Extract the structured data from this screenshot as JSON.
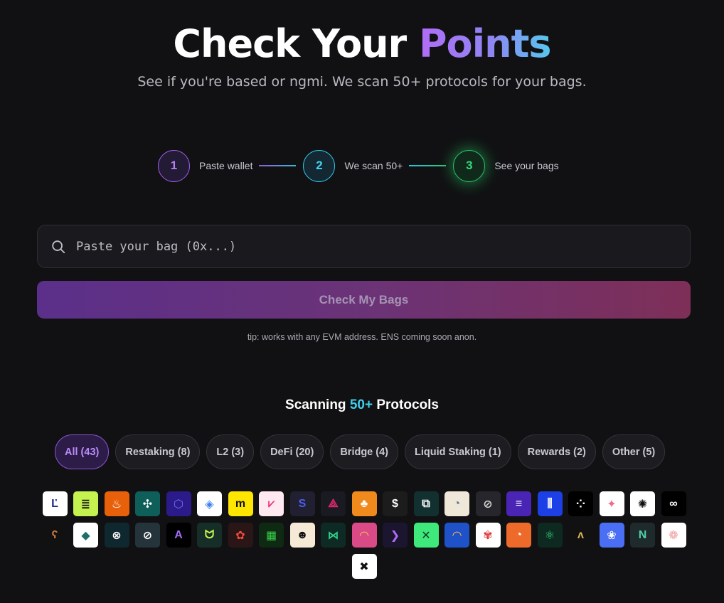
{
  "hero": {
    "title_main": "Check Your ",
    "title_accent": "Points",
    "subtitle": "See if you're based or ngmi. We scan 50+ protocols for your bags."
  },
  "steps": [
    {
      "number": "1",
      "label": "Paste wallet"
    },
    {
      "number": "2",
      "label": "We scan 50+"
    },
    {
      "number": "3",
      "label": "See your bags"
    }
  ],
  "search": {
    "placeholder": "Paste your bag (0x...)",
    "value": ""
  },
  "cta": {
    "label": "Check My Bags"
  },
  "tip": "tip: works with any EVM address. ENS coming soon anon.",
  "scanning": {
    "prefix": "Scanning ",
    "count": "50+",
    "suffix": " Protocols"
  },
  "filters": [
    {
      "label": "All (43)",
      "active": true
    },
    {
      "label": "Restaking (8)"
    },
    {
      "label": "L2 (3)"
    },
    {
      "label": "DeFi (20)"
    },
    {
      "label": "Bridge (4)"
    },
    {
      "label": "Liquid Staking (1)"
    },
    {
      "label": "Rewards (2)"
    },
    {
      "label": "Other (5)"
    }
  ],
  "protocol_logos": [
    {
      "icon": "L-block-logo",
      "bg": "#ffffff",
      "fg": "#1b2a8c",
      "glyph": "Ľ"
    },
    {
      "icon": "lime-stack-logo",
      "bg": "#c4f24f",
      "fg": "#111111",
      "glyph": "≣"
    },
    {
      "icon": "orange-kettle-logo",
      "bg": "#e8610a",
      "fg": "#ffffff",
      "glyph": "♨"
    },
    {
      "icon": "teal-cross-logo",
      "bg": "#0e5e5a",
      "fg": "#ffffff",
      "glyph": "✣"
    },
    {
      "icon": "blue-lattice-logo",
      "bg": "#2b1a8a",
      "fg": "#6f6af5",
      "glyph": "⬡"
    },
    {
      "icon": "blue-diamond-logo",
      "bg": "#ffffff",
      "fg": "#3a7ff2",
      "glyph": "◈"
    },
    {
      "icon": "yellow-m-logo",
      "bg": "#ffe600",
      "fg": "#111111",
      "glyph": "m"
    },
    {
      "icon": "pink-v-logo",
      "bg": "#fde9ef",
      "fg": "#f0347a",
      "glyph": "⩗"
    },
    {
      "icon": "blue-s-logo",
      "bg": "#202030",
      "fg": "#4d5ff5",
      "glyph": "S"
    },
    {
      "icon": "pink-triad-logo",
      "bg": "#1a1a22",
      "fg": "#e5286f",
      "glyph": "⟁"
    },
    {
      "icon": "orange-corn-logo",
      "bg": "#f08a1c",
      "fg": "#ffffff",
      "glyph": "♣"
    },
    {
      "icon": "dollar-circle-logo",
      "bg": "#1c1c1c",
      "fg": "#ffffff",
      "glyph": "$"
    },
    {
      "icon": "green-square-logo",
      "bg": "#133030",
      "fg": "#ffffff",
      "glyph": "⧉"
    },
    {
      "icon": "gray-pie-logo",
      "bg": "#efe7d8",
      "fg": "#4a7a9a",
      "glyph": "◔"
    },
    {
      "icon": "hand-circle-logo",
      "bg": "#26262c",
      "fg": "#d6d6d6",
      "glyph": "⊘"
    },
    {
      "icon": "purple-slash-logo",
      "bg": "#4a25b5",
      "fg": "#ffffff",
      "glyph": "≡"
    },
    {
      "icon": "blue-bars-logo",
      "bg": "#1c3fe6",
      "fg": "#ffffff",
      "glyph": "⫼"
    },
    {
      "icon": "black-dots-logo",
      "bg": "#000000",
      "fg": "#ffffff",
      "glyph": "⁘"
    },
    {
      "icon": "pink-star-logo",
      "bg": "#ffffff",
      "fg": "#f06a8a",
      "glyph": "✦"
    },
    {
      "icon": "black-pinwheel-logo",
      "bg": "#ffffff",
      "fg": "#111111",
      "glyph": "✺"
    },
    {
      "icon": "infinity-logo",
      "bg": "#000000",
      "fg": "#ffffff",
      "glyph": "∞"
    },
    {
      "icon": "brown-bear-logo",
      "bg": "#111111",
      "fg": "#c8783a",
      "glyph": "ʕ"
    },
    {
      "icon": "teal-chevron-logo",
      "bg": "#ffffff",
      "fg": "#1f6e6a",
      "glyph": "◆"
    },
    {
      "icon": "circle-x-logo",
      "bg": "#0f2830",
      "fg": "#ffffff",
      "glyph": "⊗"
    },
    {
      "icon": "striped-circle-logo",
      "bg": "#25333a",
      "fg": "#ffffff",
      "glyph": "⊘"
    },
    {
      "icon": "purple-a-logo",
      "bg": "#000000",
      "fg": "#a06cf0",
      "glyph": "A"
    },
    {
      "icon": "lime-loop-logo",
      "bg": "#152e28",
      "fg": "#c6f24d",
      "glyph": "ᗢ"
    },
    {
      "icon": "red-flower-logo",
      "bg": "#2a1616",
      "fg": "#f24a3a",
      "glyph": "✿"
    },
    {
      "icon": "green-block-logo",
      "bg": "#0f2a12",
      "fg": "#37d14a",
      "glyph": "▦"
    },
    {
      "icon": "cartoon-face-logo",
      "bg": "#f6ead6",
      "fg": "#111111",
      "glyph": "☻"
    },
    {
      "icon": "green-bowtie-logo",
      "bg": "#0e2a24",
      "fg": "#2fd18a",
      "glyph": "⋈"
    },
    {
      "icon": "pink-gauge-logo",
      "bg": "#d94a86",
      "fg": "#f5c64a",
      "glyph": "◠"
    },
    {
      "icon": "purple-arrow-logo",
      "bg": "#1b1530",
      "fg": "#b06cf6",
      "glyph": "❯"
    },
    {
      "icon": "green-x-logo",
      "bg": "#3ee87a",
      "fg": "#0b3d25",
      "glyph": "✕"
    },
    {
      "icon": "rainbow-logo",
      "bg": "#1f52c8",
      "fg": "#ffb84a",
      "glyph": "◠"
    },
    {
      "icon": "red-lotus-logo",
      "bg": "#ffffff",
      "fg": "#e03a3a",
      "glyph": "✾"
    },
    {
      "icon": "orange-swirl-logo",
      "bg": "#ed6a2a",
      "fg": "#ffffff",
      "glyph": "◔"
    },
    {
      "icon": "green-atom-logo",
      "bg": "#0e2a20",
      "fg": "#35d979",
      "glyph": "⚛"
    },
    {
      "icon": "gold-a-logo",
      "bg": "#111111",
      "fg": "#d8b45a",
      "glyph": "ᴧ"
    },
    {
      "icon": "blue-flower-logo",
      "bg": "#4a6ff5",
      "fg": "#ffffff",
      "glyph": "❀"
    },
    {
      "icon": "teal-n-logo",
      "bg": "#1e2a2c",
      "fg": "#4fd1a8",
      "glyph": "Ν"
    },
    {
      "icon": "paw-logo",
      "bg": "#ffffff",
      "fg": "#f0a0a0",
      "glyph": "❁"
    },
    {
      "icon": "black-x-logo",
      "bg": "#ffffff",
      "fg": "#111111",
      "glyph": "✖"
    }
  ]
}
